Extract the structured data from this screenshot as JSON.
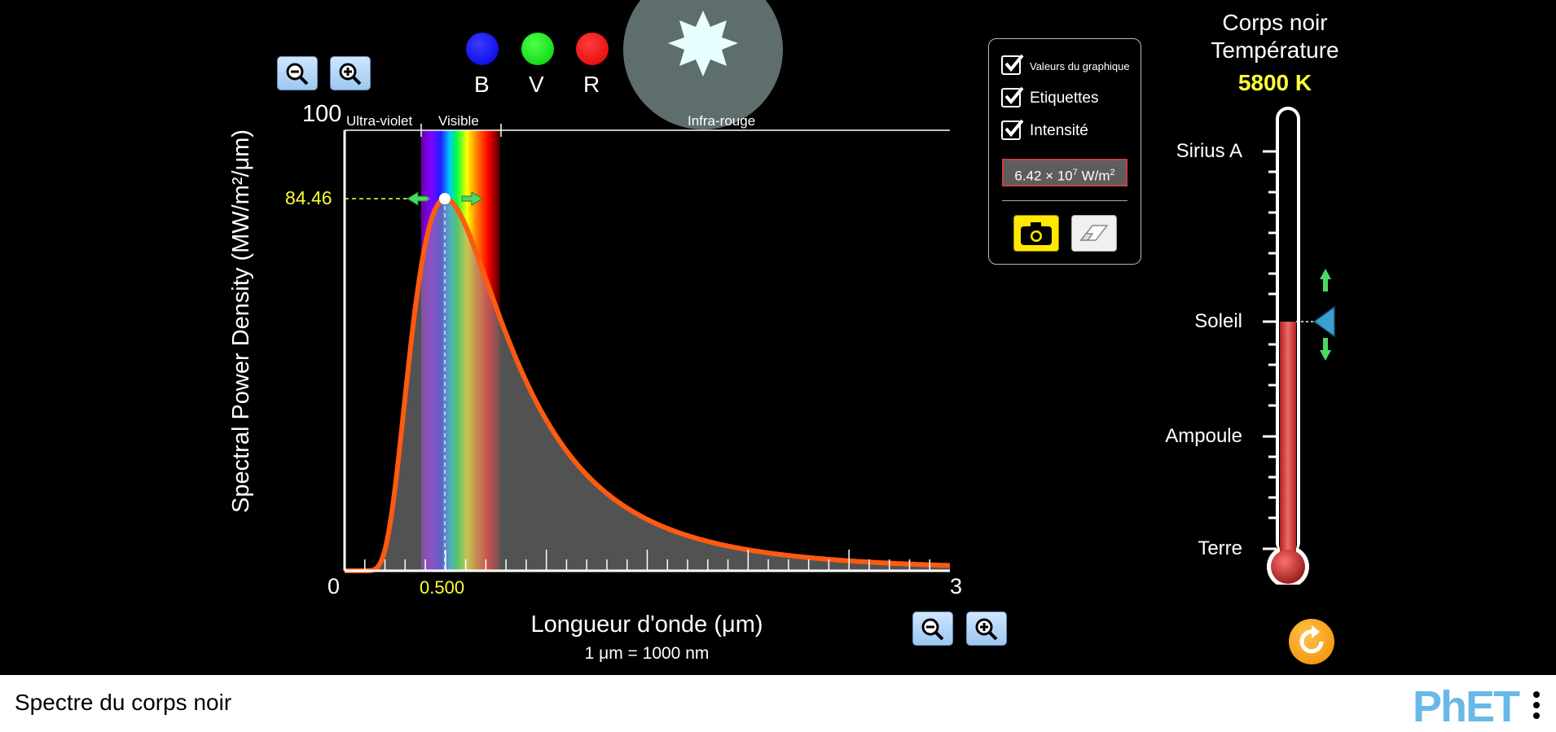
{
  "graph": {
    "y_max_label": "100",
    "y_zero_label": "0",
    "x_max_label": "3",
    "y_axis_title": "Spectral Power Density (MW/m²/μm)",
    "x_axis_title": "Longueur d'onde (μm)",
    "x_axis_subtitle": "1 μm  =  1000 nm",
    "peak_value": "84.46",
    "peak_wavelength": "0.500",
    "band_labels": {
      "uv": "Ultra-violet",
      "visible": "Visible",
      "ir": "Infra-rouge"
    }
  },
  "chart_data": {
    "type": "line",
    "x_range": [
      0,
      3
    ],
    "y_range": [
      0,
      100
    ],
    "temperature_K": 5800,
    "peak": {
      "x": 0.5,
      "y": 84.46
    },
    "series": [
      {
        "x": [
          0.1,
          0.2,
          0.3,
          0.4,
          0.5,
          0.6,
          0.7,
          0.8,
          1.0,
          1.2,
          1.5,
          2.0,
          2.5,
          3.0
        ],
        "y": [
          0.0,
          8.0,
          50.0,
          81.0,
          84.46,
          76.0,
          65.0,
          55.0,
          38.0,
          26.0,
          15.0,
          6.0,
          3.0,
          1.6
        ]
      }
    ]
  },
  "bvr": {
    "b": "B",
    "v": "V",
    "r": "R"
  },
  "options": {
    "graph_values": "Valeurs du graphique",
    "labels": "Etiquettes",
    "intensity": "Intensité",
    "intensity_mantissa": "6.42 × 10",
    "intensity_exp": "7",
    "intensity_unit": " W/m",
    "intensity_unit_exp": "2"
  },
  "thermometer": {
    "title_line1": "Corps noir",
    "title_line2": "Température",
    "temperature": "5800 K",
    "markers": [
      "Sirius A",
      "Soleil",
      "Ampoule",
      "Terre"
    ]
  },
  "footer": {
    "title": "Spectre du corps noir",
    "logo": "PhET"
  },
  "colors": {
    "curve": "#ff5a10",
    "peak_text": "#ffff33",
    "temperature_text": "#ffff33",
    "mercury": "#d94040",
    "accent_arrow": "#4cd964"
  }
}
